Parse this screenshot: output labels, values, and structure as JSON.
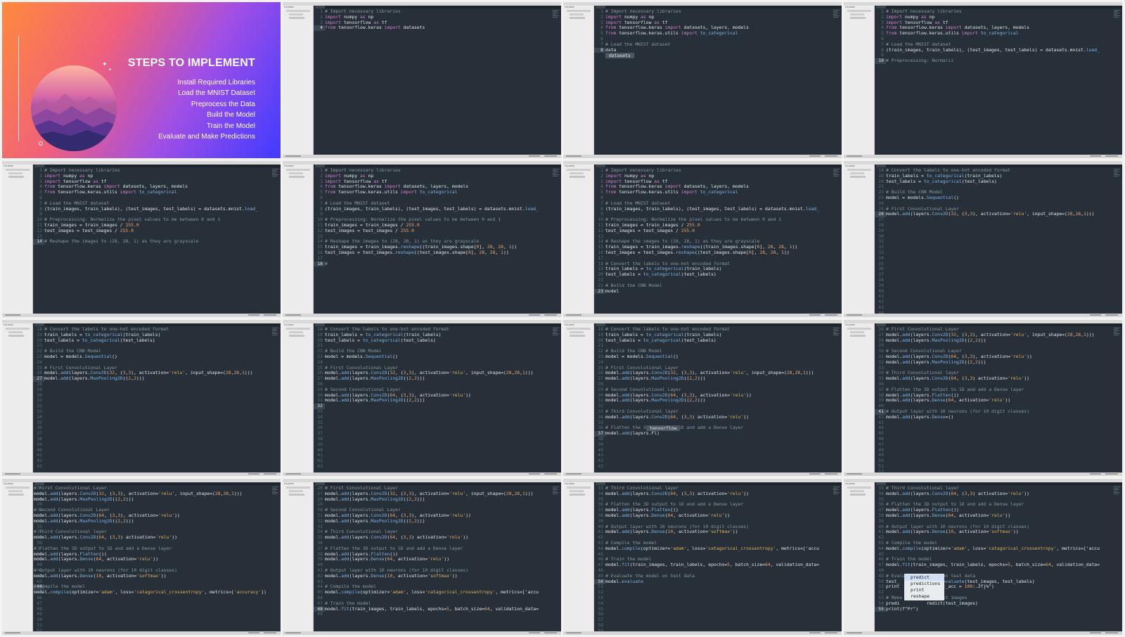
{
  "slide": {
    "title": "STEPS TO IMPLEMENT",
    "steps": [
      "Install Required Libraries",
      "Load the MNIST Dataset",
      "Preprocess the Data",
      "Build the Model",
      "Train the Model",
      "Evaluate and Make Predictions"
    ]
  },
  "editor": {
    "folder": "FOLDERS"
  },
  "tiles": [
    {
      "start": 1,
      "cursor": 4,
      "lines": [
        "# Import necessary libraries",
        "import numpy as np",
        "import tensorflow as tf",
        "from tensorflow.keras import datasets"
      ]
    },
    {
      "start": 1,
      "cursor": 8,
      "autocomplete": "datasets",
      "lines": [
        "# Import necessary libraries",
        "import numpy as np",
        "import tensorflow as tf",
        "from tensorflow.keras import datasets, layers, models",
        "from tensorflow.keras.utils import to_categorical",
        "",
        "# Load the MNIST dataset",
        "data"
      ]
    },
    {
      "start": 1,
      "cursor": 10,
      "lines": [
        "# Import necessary libraries",
        "import numpy as np",
        "import tensorflow as tf",
        "from tensorflow.keras import datasets, layers, models",
        "from tensorflow.keras.utils import to_categorical",
        "",
        "# Load the MNIST dataset",
        "(train_images, train_labels), (test_images, test_labels) = datasets.mnist.load_",
        "",
        "# Preprocessing: Normaliz"
      ]
    },
    {
      "start": 1,
      "cursor": 14,
      "lines": [
        "# Import necessary libraries",
        "import numpy as np",
        "import tensorflow as tf",
        "from tensorflow.keras import datasets, layers, models",
        "from tensorflow.keras.utils import to_categorical",
        "",
        "# Load the MNIST dataset",
        "(train_images, train_labels), (test_images, test_labels) = datasets.mnist.load_",
        "",
        "# Preprocessing: Normalize the pixel values to be between 0 and 1",
        "train_images = train_images / 255.0",
        "test_images = test_images / 255.0",
        "",
        "# Reshape the images to (28, 28, 1) as they are grayscale"
      ]
    },
    {
      "start": 1,
      "cursor": 18,
      "lines": [
        "# Import necessary libraries",
        "import numpy as np",
        "import tensorflow as tf",
        "from tensorflow.keras import datasets, layers, models",
        "from tensorflow.keras.utils import to_categorical",
        "",
        "# Load the MNIST dataset",
        "(train_images, train_labels), (test_images, test_labels) = datasets.mnist.load_",
        "",
        "# Preprocessing: Normalize the pixel values to be between 0 and 1",
        "train_images = train_images / 255.0",
        "test_images = test_images / 255.0",
        "",
        "# Reshape the images to (28, 28, 1) as they are grayscale",
        "train_images = train_images.reshape((train_images.shape[0], 28, 28, 1))",
        "test_images = test_images.reshape((test_images.shape[0], 28, 28, 1))",
        "",
        "#"
      ]
    },
    {
      "start": 1,
      "cursor": 23,
      "lines": [
        "# Import necessary libraries",
        "import numpy as np",
        "import tensorflow as tf",
        "from tensorflow.keras import datasets, layers, models",
        "from tensorflow.keras.utils import to_categorical",
        "",
        "# Load the MNIST dataset",
        "(train_images, train_labels), (test_images, test_labels) = datasets.mnist.load_",
        "",
        "# Preprocessing: Normalize the pixel values to be between 0 and 1",
        "train_images = train_images / 255.0",
        "test_images = test_images / 255.0",
        "",
        "# Reshape the images to (28, 28, 1) as they are grayscale",
        "train_images = train_images.reshape((train_images.shape[0], 28, 28, 1))",
        "test_images = test_images.reshape((test_images.shape[0], 28, 28, 1))",
        "",
        "# Convert the labels to one-hot encoded format",
        "train_labels = to_categorical(train_labels)",
        "test_labels = to_categorical(test_labels)",
        "",
        "# Build the CNN Model",
        "model"
      ]
    },
    {
      "start": 18,
      "cursor": 26,
      "lines": [
        "# Convert the labels to one-hot encoded format",
        "train_labels = to_categorical(train_labels)",
        "test_labels = to_categorical(test_labels)",
        "",
        "# Build the CNN Model",
        "model = models.Sequential()",
        "",
        "# First Convolutional Layer",
        "model.add(layers.Conv2D(32, (3,3), activation='relu', input_shape=(28,28,1)))",
        "",
        "",
        "",
        "",
        "",
        "",
        "",
        "",
        "",
        "",
        "",
        "",
        "",
        "",
        "",
        "",
        "",
        ""
      ]
    },
    {
      "start": 18,
      "cursor": 27,
      "lines": [
        "# Convert the labels to one-hot encoded format",
        "train_labels = to_categorical(train_labels)",
        "test_labels = to_categorical(test_labels)",
        "",
        "# Build the CNN Model",
        "model = models.Sequential()",
        "",
        "# First Convolutional Layer",
        "model.add(layers.Conv2D(32, (3,3), activation='relu', input_shape=(28,28,1)))",
        "model.add(layers.MaxPooling2D((2,2)))",
        "",
        "",
        "",
        "",
        "",
        "",
        "",
        "",
        "",
        "",
        "",
        "",
        "",
        "",
        "",
        ""
      ]
    },
    {
      "start": 18,
      "cursor": 32,
      "lines": [
        "# Convert the labels to one-hot encoded format",
        "train_labels = to_categorical(train_labels)",
        "test_labels = to_categorical(test_labels)",
        "",
        "# Build the CNN Model",
        "model = models.Sequential()",
        "",
        "# First Convolutional Layer",
        "model.add(layers.Conv2D(32, (3,3), activation='relu', input_shape=(28,28,1)))",
        "model.add(layers.MaxPooling2D((2,2)))",
        "",
        "# Second Convolutional Layer",
        "model.add(layers.Conv2D(64, (3,3), activation='relu'))",
        "model.add(layers.MaxPooling2D((2,2)))",
        "",
        "",
        "",
        "",
        "",
        "",
        "",
        "",
        "",
        "",
        "",
        ""
      ]
    },
    {
      "start": 18,
      "cursor": 37,
      "autocomplete": "tensorflow",
      "lines": [
        "# Convert the labels to one-hot encoded format",
        "train_labels = to_categorical(train_labels)",
        "test_labels = to_categorical(test_labels)",
        "",
        "# Build the CNN Model",
        "model = models.Sequential()",
        "",
        "# First Convolutional Layer",
        "model.add(layers.Conv2D(32, (3,3), activation='relu', input_shape=(28,28,1)))",
        "model.add(layers.MaxPooling2D((2,2)))",
        "",
        "# Second Convolutional Layer",
        "model.add(layers.Conv2D(64, (3,3), activation='relu'))",
        "model.add(layers.MaxPooling2D((2,2)))",
        "",
        "# Third Convolutional layer",
        "model.add(layers.Conv2D(64, (3,3) activation='relu'))",
        "",
        "# Flatten the 3D output to 1D and add a Dense layer",
        "model.add(layers.Fl)",
        "",
        "",
        "",
        "",
        "",
        ""
      ]
    },
    {
      "start": 26,
      "cursor": 41,
      "lines": [
        "# First Convolutional Layer",
        "model.add(layers.Conv2D(32, (3,3), activation='relu', input_shape=(28,28,1)))",
        "model.add(layers.MaxPooling2D((2,2)))",
        "",
        "# Second Convolutional Layer",
        "model.add(layers.Conv2D(64, (3,3), activation='relu'))",
        "model.add(layers.MaxPooling2D((2,2)))",
        "",
        "# Third Convolutional layer",
        "model.add(layers.Conv2D(64, (3,3) activation='relu'))",
        "",
        "# Flatten the 3D output to 1D and add a Dense layer",
        "model.add(layers.Flatten())",
        "model.add(layers.Dense(64, activation='relu'))",
        "",
        "# Output layer with 10 neurons (for 10 digit classes)",
        "model.add(layers.Dense=()",
        "",
        "",
        "",
        "",
        "",
        "",
        "",
        "",
        "",
        "",
        ""
      ]
    },
    {
      "start": 26,
      "cursor": 44,
      "shift": true,
      "lines": [
        "# First Convolutional Layer",
        "model.add(layers.Conv2D(32, (3,3), activation='relu', input_shape=(28,28,1)))",
        "model.add(layers.MaxPooling2D((2,2)))",
        "",
        "# Second Convolutional Layer",
        "model.add(layers.Conv2D(64, (3,3), activation='relu'))",
        "model.add(layers.MaxPooling2D((2,2)))",
        "",
        "# Third Convolutional layer",
        "model.add(layers.Conv2D(64, (3,3) activation='relu'))",
        "",
        "# Flatten the 3D output to 1D and add a Dense layer",
        "model.add(layers.Flatten())",
        "model.add(layers.Dense(64, activation='relu'))",
        "",
        "# Output layer with 10 neurons (for 10 digit classes)",
        "model.add(layers.Dense(10, activation='softmax'))",
        "",
        "# Compile the model",
        "model.compile(optimizer='adam', loss='catagorical_crossentropy', metrics=['accuracy'])",
        "",
        "",
        "",
        "",
        "",
        "",
        ""
      ]
    },
    {
      "start": 26,
      "cursor": 48,
      "lines": [
        "# First Convolutional Layer",
        "model.add(layers.Conv2D(32, (3,3), activation='relu', input_shape=(28,28,1)))",
        "model.add(layers.MaxPooling2D((2,2)))",
        "",
        "# Second Convolutional Layer",
        "model.add(layers.Conv2D(64, (3,3), activation='relu'))",
        "model.add(layers.MaxPooling2D((2,2)))",
        "",
        "# Third Convolutional layer",
        "model.add(layers.Conv2D(64, (3,3) activation='relu'))",
        "",
        "# Flatten the 3D output to 1D and add a Dense layer",
        "model.add(layers.Flatten())",
        "model.add(layers.Dense(64, activation='relu'))",
        "",
        "# Output layer with 10 neurons (for 10 digit classes)",
        "model.add(layers.Dense(10, activation='softmax'))",
        "",
        "# Compile the model",
        "model.compile(optimizer='adam', loss='catagorical_crossentropy', metrics=['accu",
        "",
        "# Train the model",
        "model.fit(train_images, train_labels, epochs=5, batch_size=64, validation_data=",
        ""
      ]
    },
    {
      "start": 33,
      "cursor": 50,
      "lines": [
        "# Third Convolutional layer",
        "model.add(layers.Conv2D(64, (3,3) activation='relu'))",
        "",
        "# Flatten the 3D output to 1D and add a Dense layer",
        "model.add(layers.Flatten())",
        "model.add(layers.Dense(64, activation='relu'))",
        "",
        "# Output layer with 10 neurons (for 10 digit classes)",
        "model.add(layers.Dense(10, activation='softmax'))",
        "",
        "# Compile the model",
        "model.compile(optimizer='adam', loss='catagorical_crossentropy', metrics=['accu",
        "",
        "# Train the model",
        "model.fit(train_images, train_labels, epochs=5, batch_size=64, validation_data=",
        "",
        "# Evaluate the model on test data",
        "model.evaluate",
        "",
        "",
        "",
        "",
        "",
        "",
        "",
        "",
        ""
      ]
    },
    {
      "start": 33,
      "cursor": 55,
      "autocomplete_list": [
        "predict",
        "predictions",
        "print",
        "reshape"
      ],
      "lines": [
        "# Third Convolutional layer",
        "model.add(layers.Conv2D(64, (3,3) activation='relu'))",
        "",
        "# Flatten the 3D output to 1D and add a Dense layer",
        "model.add(layers.Flatten())",
        "model.add(layers.Dense(64, activation='relu'))",
        "",
        "# Output layer with 10 neurons (for 10 digit classes)",
        "model.add(layers.Dense(10, activation='softmax'))",
        "",
        "# Compile the model",
        "model.compile(optimizer='adam', loss='catagorical_crossentropy', metrics=['accu",
        "",
        "# Train the model",
        "model.fit(train_images, train_labels, epochs=5, batch_size=64, validation_data=",
        "",
        "# Evaluate the model on test data",
        "test_          model.evaluate(test_images, test_labels)",
        "print          r (test_acc = 100:.2f}%\")",
        "",
        "# Make           n test images",
        "predi          redict(test_images)",
        "print(f\"Pr\")"
      ]
    }
  ]
}
